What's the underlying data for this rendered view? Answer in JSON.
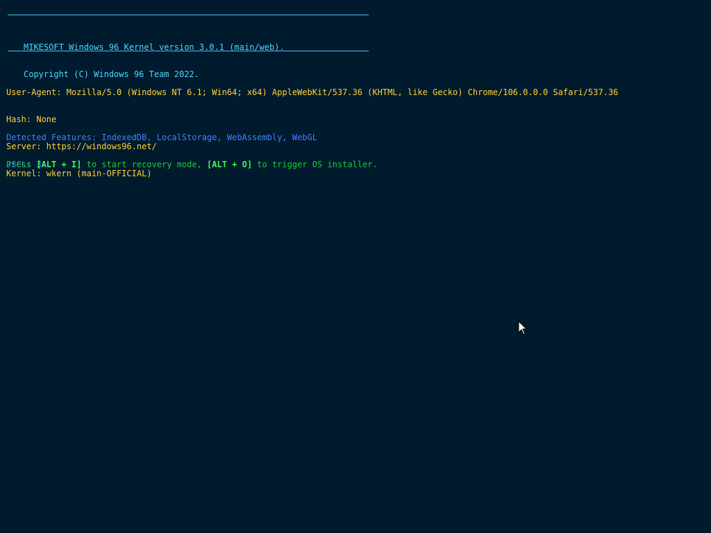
{
  "colors": {
    "background": "#001a2e",
    "rule": "#4cc3e8",
    "banner": "#4fd8ff",
    "info": "#ffd335",
    "features": "#3f82ff",
    "prompt": "#22c93c",
    "key": "#3dfc5a"
  },
  "banner": {
    "line1": "MIKESOFT Windows 96 Kernel version 3.0.1 (main/web).",
    "line2": "Copyright (C) Windows 96 Team 2022."
  },
  "info": {
    "user_agent": "User-Agent: Mozilla/5.0 (Windows NT 6.1; Win64; x64) AppleWebKit/537.36 (KHTML, like Gecko) Chrome/106.0.0.0 Safari/537.36",
    "hash": "Hash: None",
    "server": "Server: https://windows96.net/",
    "kernel": "Kernel: wkern (main-OFFICIAL)"
  },
  "features": {
    "detected": "Detected Features: IndexedDB, LocalStorage, WebAssembly, WebGL",
    "jscl": "JSCL: 3"
  },
  "prompt": {
    "press": "Press ",
    "key_recovery": "[ALT + I]",
    "mid": " to start recovery mode, ",
    "key_installer": "[ALT + O]",
    "end": " to trigger OS installer."
  },
  "cursor": {
    "icon": "mouse-pointer-icon"
  }
}
